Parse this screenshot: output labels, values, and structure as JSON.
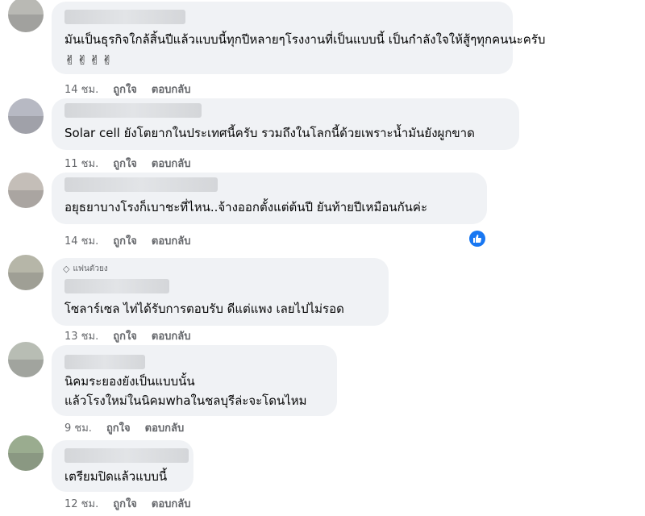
{
  "comments": [
    {
      "text": "มันเป็นธุรกิจใกล้สิ้นปีแล้วแบบนี้ทุกปีหลายๆโรงงานที่เป็นแบบนี้ เป็นกำลังใจให้สู้ๆทุกคนนะครับ",
      "emoji": "✌✌✌✌",
      "time": "14 ชม.",
      "like": "ถูกใจ",
      "reply": "ตอบกลับ"
    },
    {
      "text": "Solar cell ยังโตยากในประเทศนี้ครับ รวมถึงในโลกนี้ด้วยเพราะน้ำมันยังผูกขาด",
      "time": "11 ชม.",
      "like": "ถูกใจ",
      "reply": "ตอบกลับ"
    },
    {
      "text": "อยุธยาบางโรงก็เบาชะที่ไหน..จ้างออกตั้งแต่ต้นปี ยันท้ายปีเหมือนกันค่ะ",
      "time": "14 ชม.",
      "like": "ถูกใจ",
      "reply": "ตอบกลับ",
      "reaction_icon": "like-icon"
    },
    {
      "badge": "แฟนตัวยง",
      "text": "โซลาร์เซล ไท่ได้รับการตอบรับ ดีแต่แพง เลยไปไม่รอด",
      "time": "13 ชม.",
      "like": "ถูกใจ",
      "reply": "ตอบกลับ"
    },
    {
      "text_line1": "นิคมระยองยังเป็นแบบนั้น",
      "text_line2": "แล้วโรงใหม่ในนิคมwhaในชลบุรีล่ะจะโดนไหม",
      "time": "9 ชม.",
      "like": "ถูกใจ",
      "reply": "ตอบกลับ"
    },
    {
      "text": "เตรียมปิดแล้วแบบนี้",
      "time": "12 ชม.",
      "like": "ถูกใจ",
      "reply": "ตอบกลับ"
    }
  ],
  "colors": {
    "bubble": "#f0f2f5",
    "secondary_text": "#65676b",
    "reaction_blue": "#1877f2"
  }
}
